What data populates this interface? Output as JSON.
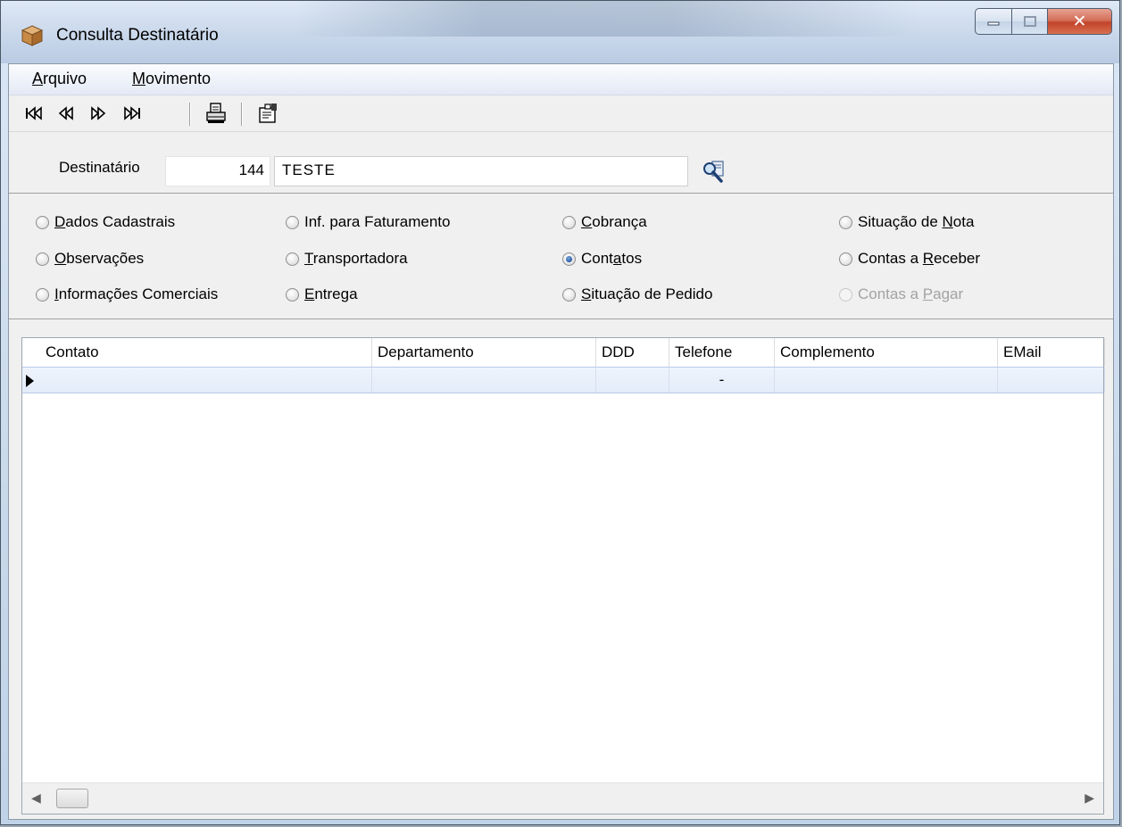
{
  "window": {
    "title": "Consulta Destinatário"
  },
  "menu": {
    "items": [
      {
        "label": "Arquivo",
        "mnemonic": "A"
      },
      {
        "label": "Movimento",
        "mnemonic": "M"
      }
    ]
  },
  "toolbar": {
    "buttons": [
      "first-record-icon",
      "previous-record-icon",
      "next-record-icon",
      "last-record-icon",
      "print-icon",
      "properties-icon"
    ]
  },
  "destinatario": {
    "label": "Destinatário",
    "code": "144",
    "name": "TESTE"
  },
  "options": [
    {
      "label": "Dados Cadastrais",
      "mnemonic_index": 0,
      "checked": false,
      "disabled": false
    },
    {
      "label": "Inf. para Faturamento",
      "mnemonic_index": -1,
      "checked": false,
      "disabled": false
    },
    {
      "label": "Cobrança",
      "mnemonic_index": 0,
      "checked": false,
      "disabled": false
    },
    {
      "label": "Situação de Nota",
      "mnemonic_index": 12,
      "checked": false,
      "disabled": false
    },
    {
      "label": "Observações",
      "mnemonic_index": 0,
      "checked": false,
      "disabled": false
    },
    {
      "label": "Transportadora",
      "mnemonic_index": 0,
      "checked": false,
      "disabled": false
    },
    {
      "label": "Contatos",
      "mnemonic_index": 4,
      "checked": true,
      "disabled": false
    },
    {
      "label": "Contas a Receber",
      "mnemonic_index": 9,
      "checked": false,
      "disabled": false
    },
    {
      "label": "Informações Comerciais",
      "mnemonic_index": 0,
      "checked": false,
      "disabled": false
    },
    {
      "label": "Entrega",
      "mnemonic_index": 0,
      "checked": false,
      "disabled": false
    },
    {
      "label": "Situação de Pedido",
      "mnemonic_index": 0,
      "checked": false,
      "disabled": true
    },
    {
      "label": "Contas a Pagar",
      "mnemonic_index": 9,
      "checked": false,
      "disabled": true
    }
  ],
  "grid": {
    "columns": [
      "Contato",
      "Departamento",
      "DDD",
      "Telefone",
      "Complemento",
      "EMail"
    ],
    "rows": [
      [
        "",
        "",
        "",
        "-",
        "",
        ""
      ]
    ]
  },
  "colors": {
    "selected_row": "#e3ecf9",
    "close_button": "#c2432a"
  }
}
